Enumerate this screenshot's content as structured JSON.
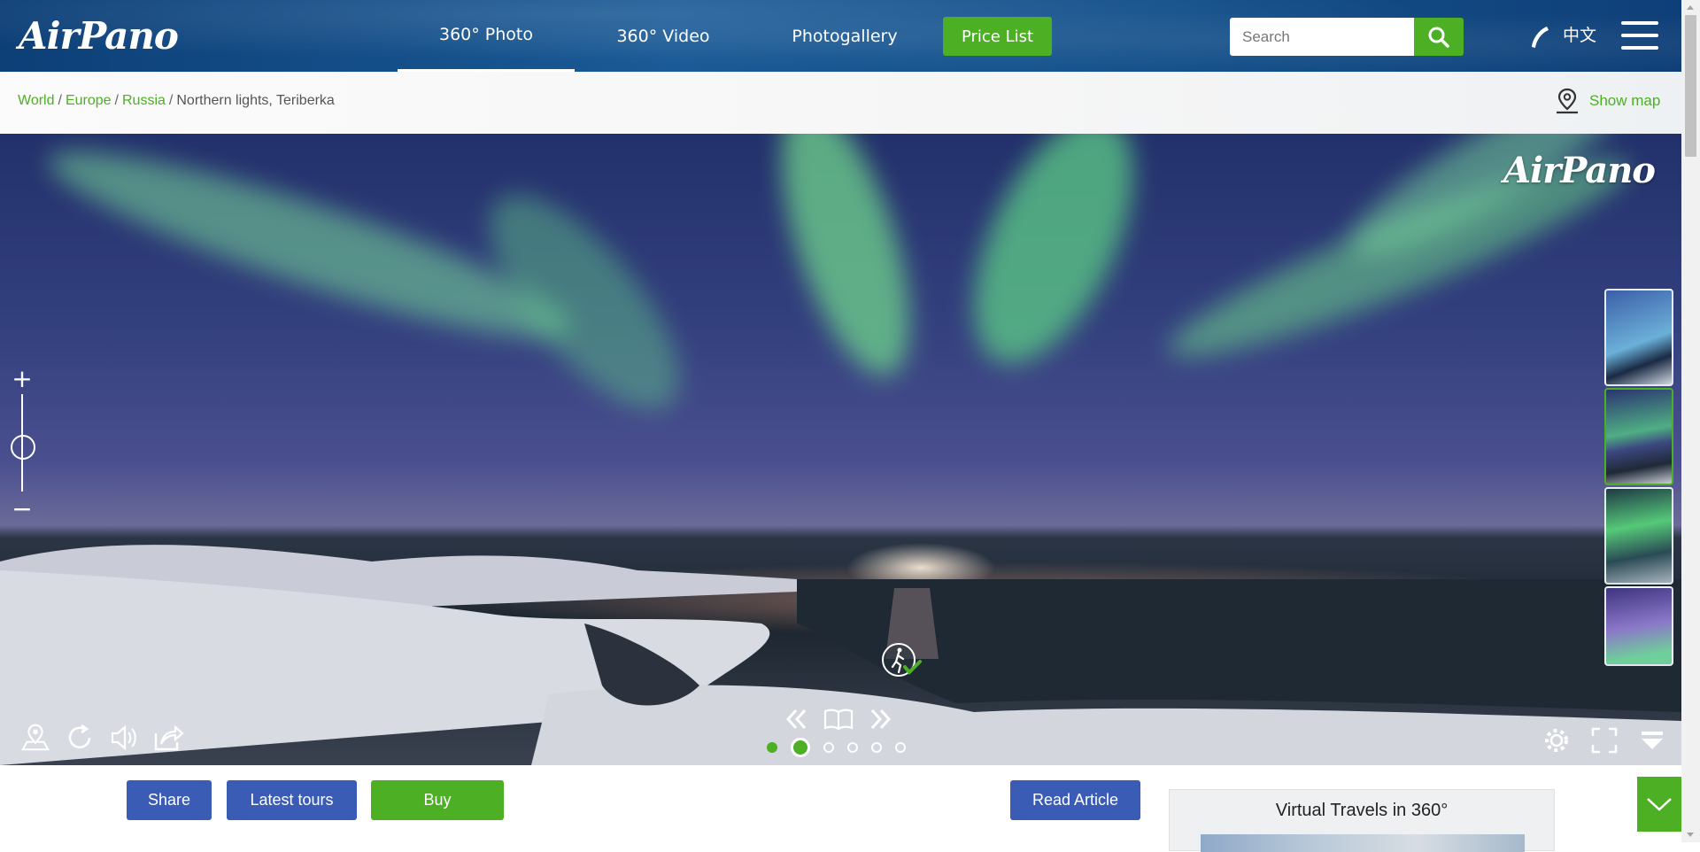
{
  "header": {
    "logo": "AirPano",
    "nav": [
      {
        "label": "360° Photo",
        "active": true
      },
      {
        "label": "360° Video",
        "active": false
      },
      {
        "label": "Photogallery",
        "active": false
      }
    ],
    "price_label": "Price List",
    "search": {
      "placeholder": "Search",
      "value": ""
    },
    "language": "中文",
    "icons": [
      "search-icon",
      "phone-icon",
      "hamburger-menu-icon"
    ]
  },
  "breadcrumb": {
    "items": [
      "World",
      "Europe",
      "Russia"
    ],
    "current": "Northern lights, Teriberka",
    "separator": "/"
  },
  "map_link": {
    "label": "Show map",
    "icon": "map-pin-icon"
  },
  "viewer": {
    "watermark": "AirPano",
    "zoom": {
      "plus": "+",
      "minus": "−"
    },
    "thumbnails_count": 4,
    "selected_thumbnail": 2,
    "pager": {
      "total": 6,
      "current": 2
    },
    "icons_left": [
      "map-marker-icon",
      "rotate-icon",
      "sound-icon",
      "share-arrow-icon"
    ],
    "icons_center": [
      "previous-icon",
      "book-icon",
      "next-icon"
    ],
    "icons_right": [
      "settings-gear-icon",
      "fullscreen-icon",
      "collapse-icon"
    ]
  },
  "buttons": {
    "share": "Share",
    "latest": "Latest tours",
    "buy": "Buy",
    "read": "Read Article"
  },
  "sidebar_card": {
    "title": "Virtual Travels in 360°"
  },
  "colors": {
    "brand_green": "#4caf24",
    "brand_blue": "#3a5cb5",
    "header_blue": "#14508a"
  }
}
